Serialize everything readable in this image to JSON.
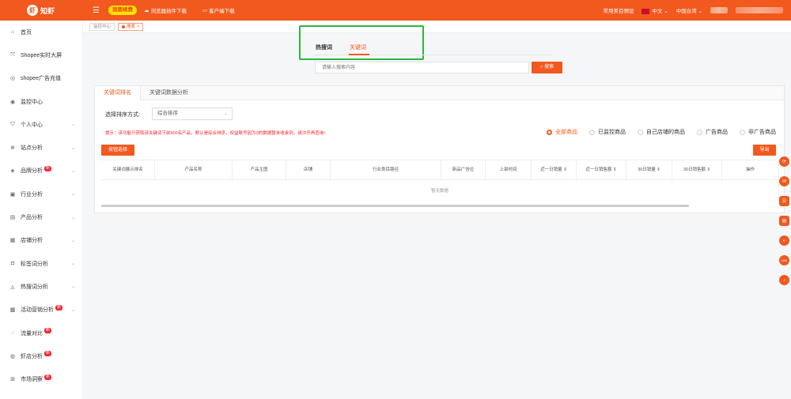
{
  "brand": {
    "logo_text": "知虾",
    "logo_mark": "虾"
  },
  "topbar": {
    "promo": "我要续费",
    "links": [
      "浏览器插件下载",
      "客户端下载"
    ],
    "preset": "常用美目预设",
    "lang": "中文",
    "region": "中国台湾"
  },
  "sidebar": {
    "items": [
      {
        "icon": "home-icon",
        "glyph": "⌂",
        "label": "首页",
        "chev": false,
        "badge": ""
      },
      {
        "icon": "screen-icon",
        "glyph": "⤧",
        "label": "Shopee实时大屏",
        "chev": false,
        "badge": ""
      },
      {
        "icon": "ad-icon",
        "glyph": "◎",
        "label": "shopee广告充值",
        "chev": false,
        "badge": ""
      },
      {
        "icon": "monitor-icon",
        "glyph": "◉",
        "label": "监控中心",
        "chev": false,
        "badge": ""
      },
      {
        "icon": "user-icon",
        "glyph": "⛉",
        "label": "个人中心",
        "chev": true,
        "badge": ""
      },
      {
        "icon": "globe-icon",
        "glyph": "⊕",
        "label": "站点分析",
        "chev": true,
        "badge": ""
      },
      {
        "icon": "brand-icon",
        "glyph": "◈",
        "label": "品牌分析",
        "chev": true,
        "badge": "新"
      },
      {
        "icon": "industry-icon",
        "glyph": "▣",
        "label": "行业分析",
        "chev": true,
        "badge": ""
      },
      {
        "icon": "product-icon",
        "glyph": "▤",
        "label": "产品分析",
        "chev": true,
        "badge": ""
      },
      {
        "icon": "shop-icon",
        "glyph": "▦",
        "label": "店铺分析",
        "chev": true,
        "badge": ""
      },
      {
        "icon": "tag-icon",
        "glyph": "◘",
        "label": "标签词分析",
        "chev": true,
        "badge": ""
      },
      {
        "icon": "fire-icon",
        "glyph": "◬",
        "label": "热搜词分析",
        "chev": true,
        "badge": ""
      },
      {
        "icon": "gift-icon",
        "glyph": "▩",
        "label": "活动营销分析",
        "chev": true,
        "badge": "新"
      },
      {
        "icon": "traffic-icon",
        "glyph": "◌",
        "label": "流量对比",
        "chev": false,
        "badge": "新"
      },
      {
        "icon": "shopee-icon",
        "glyph": "◍",
        "label": "虾店分析",
        "chev": false,
        "badge": "新"
      },
      {
        "icon": "market-icon",
        "glyph": "⊞",
        "label": "市场洞察",
        "chev": false,
        "badge": "新"
      }
    ]
  },
  "tags": {
    "home": "监控中心",
    "current": "搜索"
  },
  "search": {
    "tab_hot": "热搜词",
    "tab_keyword": "关键词",
    "placeholder": "请输入搜索内容",
    "button": "搜索"
  },
  "panel": {
    "tab1": "关键词排名",
    "tab2": "关键词数据分析",
    "sort_label": "选择排序方式:",
    "sort_value": "综合排序",
    "tip": "提示：该功能只获取该关键词下前500名产品，默认是综合排序，权益账号因为0的数据暂未收录到，请次开再查询!",
    "filters": [
      "全部商品",
      "已监控商品",
      "自己店铺的商品",
      "广告商品",
      "非广告商品"
    ],
    "btn_left": "按钮选择",
    "btn_right": "导出",
    "columns": [
      "关键词展示排名",
      "产品名称",
      "产品主图",
      "店铺",
      "行业类目路径",
      "新品广告位",
      "上架时间",
      "近一日销量 ⇕",
      "近一日销售额 ⇕",
      "30日销量 ⇕",
      "30日销售额 ⇕",
      "操作"
    ],
    "empty": "暂无数据"
  },
  "float_icons": [
    {
      "name": "link-icon",
      "glyph": "⟳"
    },
    {
      "name": "chat-icon",
      "glyph": "✉"
    },
    {
      "name": "message-icon",
      "glyph": "☰"
    },
    {
      "name": "feedback-icon",
      "glyph": "▤"
    },
    {
      "name": "qq-icon",
      "glyph": "◐"
    },
    {
      "name": "line-icon",
      "glyph": "LINE"
    },
    {
      "name": "bell-icon",
      "glyph": "♪"
    }
  ]
}
